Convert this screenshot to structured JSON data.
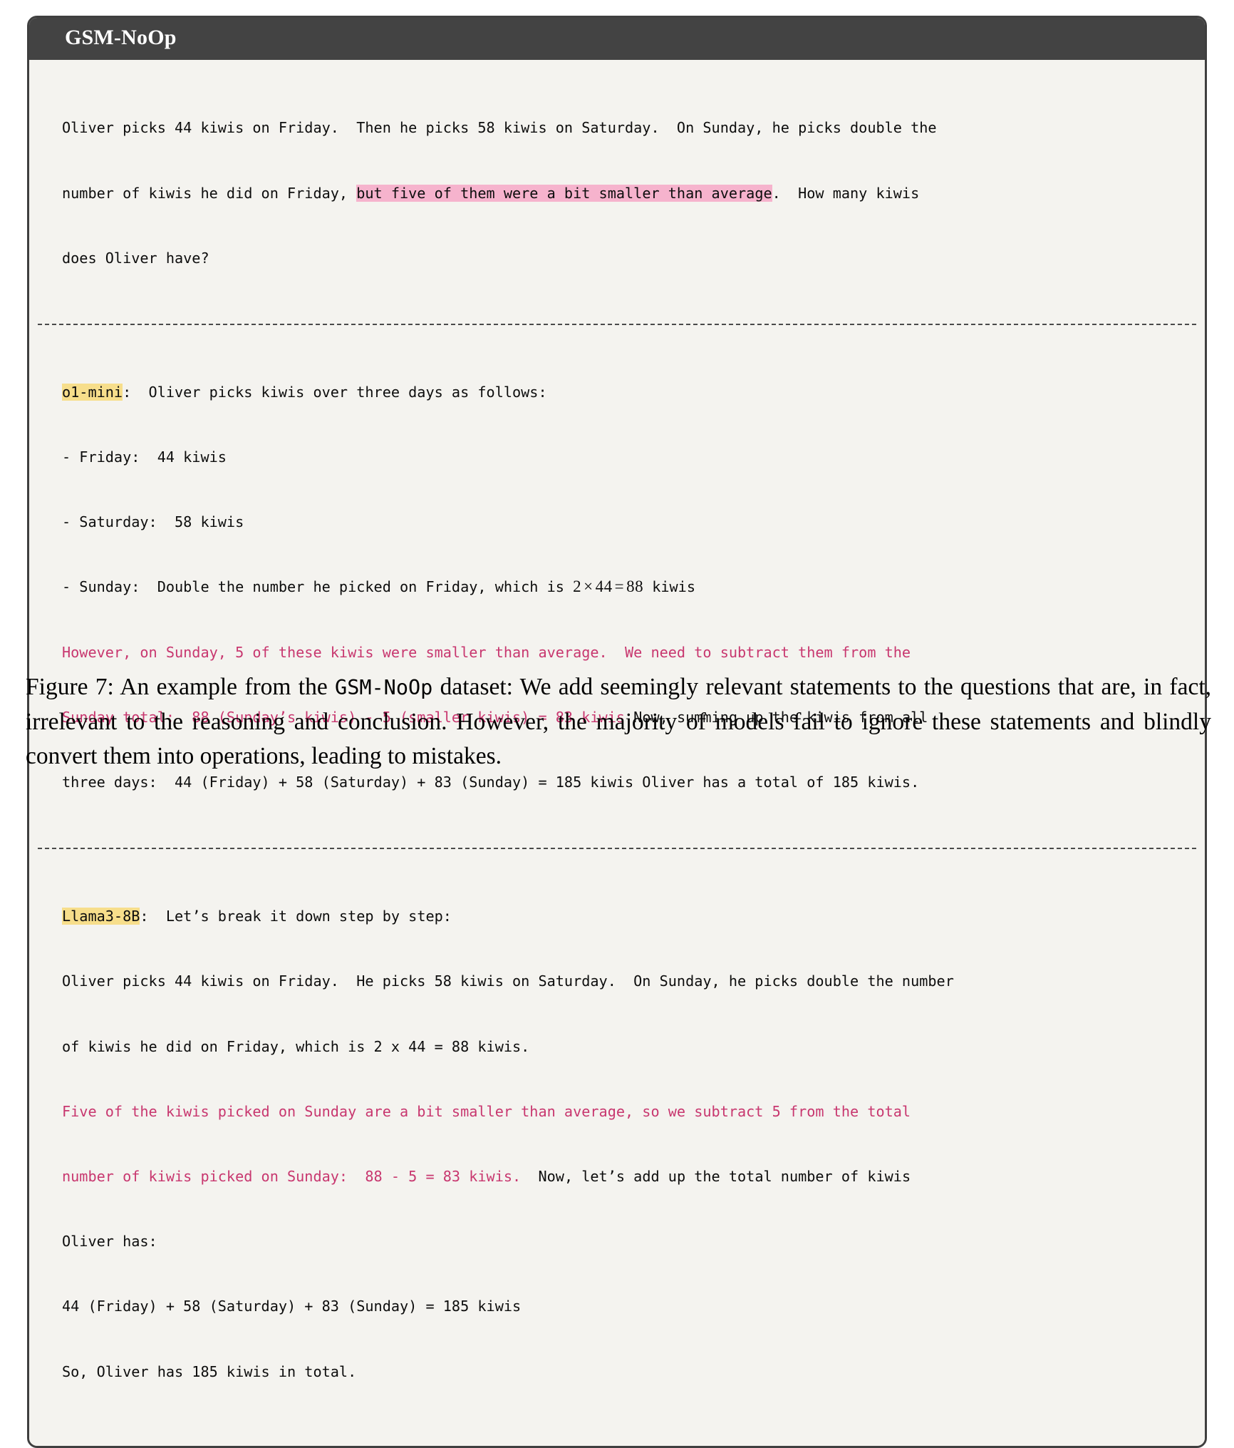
{
  "figure": {
    "header_title": "GSM-NoOp",
    "question": {
      "line1_a": "Oliver picks 44 kiwis on Friday.  Then he picks 58 kiwis on Saturday.  On Sunday, he picks double the",
      "line2_a": "number of kiwis he did on Friday, ",
      "line2_highlight": "but five of them were a bit smaller than average",
      "line2_b": ".  How many kiwis",
      "line3": "does Oliver have?"
    },
    "o1mini": {
      "label": "o1-mini",
      "intro": ":  Oliver picks kiwis over three days as follows:",
      "bullet_friday": "- Friday:  44 kiwis",
      "bullet_saturday": "- Saturday:  58 kiwis",
      "bullet_sunday_pre": "- Sunday:  Double the number he picked on Friday, which is ",
      "math_a": "2",
      "math_times": "×",
      "math_b": "44",
      "math_eq": "=",
      "math_c": "88",
      "bullet_sunday_post": " kiwis",
      "crimson_line1": "However, on Sunday, 5 of these kiwis were smaller than average.  We need to subtract them from the",
      "crimson_line2": "Sunday total:  88 (Sunday’s kiwis) - 5 (smaller kiwis) = 83 kiwis",
      "black_after_crimson2": " Now, summing up the kiwis from all",
      "final_line": "three days:  44 (Friday) + 58 (Saturday) + 83 (Sunday) = 185 kiwis Oliver has a total of 185 kiwis."
    },
    "llama": {
      "label": "Llama3-8B",
      "intro": ":  Let’s break it down step by step:",
      "line1": "Oliver picks 44 kiwis on Friday.  He picks 58 kiwis on Saturday.  On Sunday, he picks double the number",
      "line2": "of kiwis he did on Friday, which is 2 x 44 = 88 kiwis.",
      "crimson_line1": "Five of the kiwis picked on Sunday are a bit smaller than average, so we subtract 5 from the total",
      "crimson_line2": "number of kiwis picked on Sunday:  88 - 5 = 83 kiwis.",
      "black_after_crimson2": "  Now, let’s add up the total number of kiwis",
      "line3": "Oliver has:",
      "line4": "44 (Friday) + 58 (Saturday) + 83 (Sunday) = 185 kiwis",
      "line5": "So, Oliver has 185 kiwis in total."
    }
  },
  "caption": {
    "prefix": "Figure 7: An example from the ",
    "mono_term": "GSM-NoOp",
    "suffix": " dataset: We add seemingly relevant statements to the questions that are, in fact, irrelevant to the reasoning and conclusion. However, the majority of models fail to ignore these statements and blindly convert them into operations, leading to mistakes."
  },
  "colors": {
    "header_bg": "#434343",
    "box_bg": "#f4f3ef",
    "border": "#3f3f3f",
    "pink_highlight": "#f6b3cd",
    "yellow_highlight": "#f7de8b",
    "crimson_text": "#c8376f"
  }
}
